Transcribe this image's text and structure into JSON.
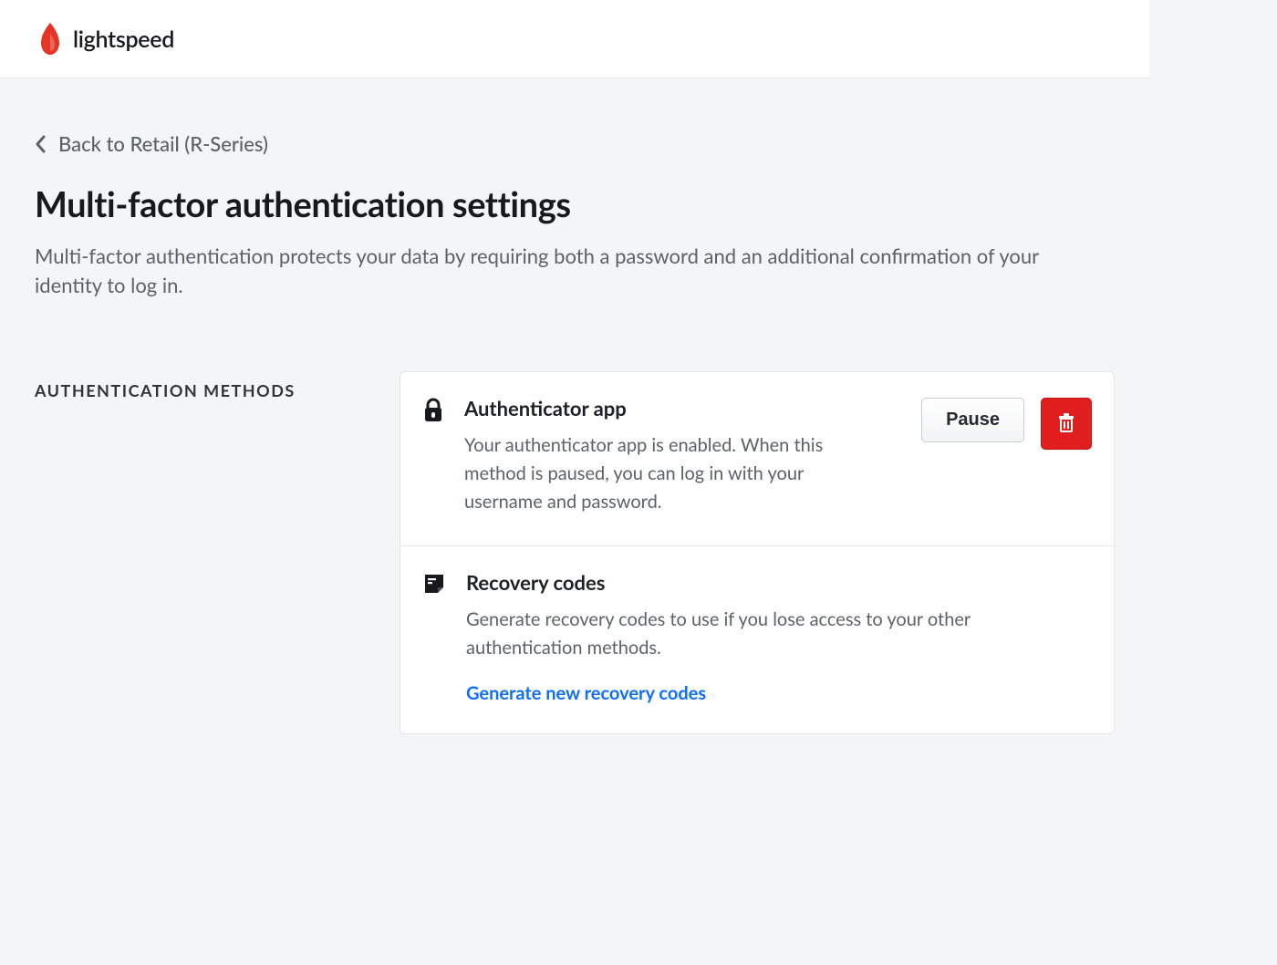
{
  "brand": {
    "name": "lightspeed"
  },
  "back_link": {
    "label": "Back to Retail (R-Series)"
  },
  "page": {
    "title": "Multi-factor authentication settings",
    "description": "Multi-factor authentication protects your data by requiring both a password and an additional confirmation of your identity to log in."
  },
  "section": {
    "label": "AUTHENTICATION METHODS"
  },
  "methods": {
    "authenticator": {
      "title": "Authenticator app",
      "description": "Your authenticator app is enabled. When this method is paused, you can log in with your username and password.",
      "pause_label": "Pause"
    },
    "recovery": {
      "title": "Recovery codes",
      "description": "Generate recovery codes to use if you lose access to your other authentication methods.",
      "generate_link": "Generate new recovery codes"
    }
  }
}
